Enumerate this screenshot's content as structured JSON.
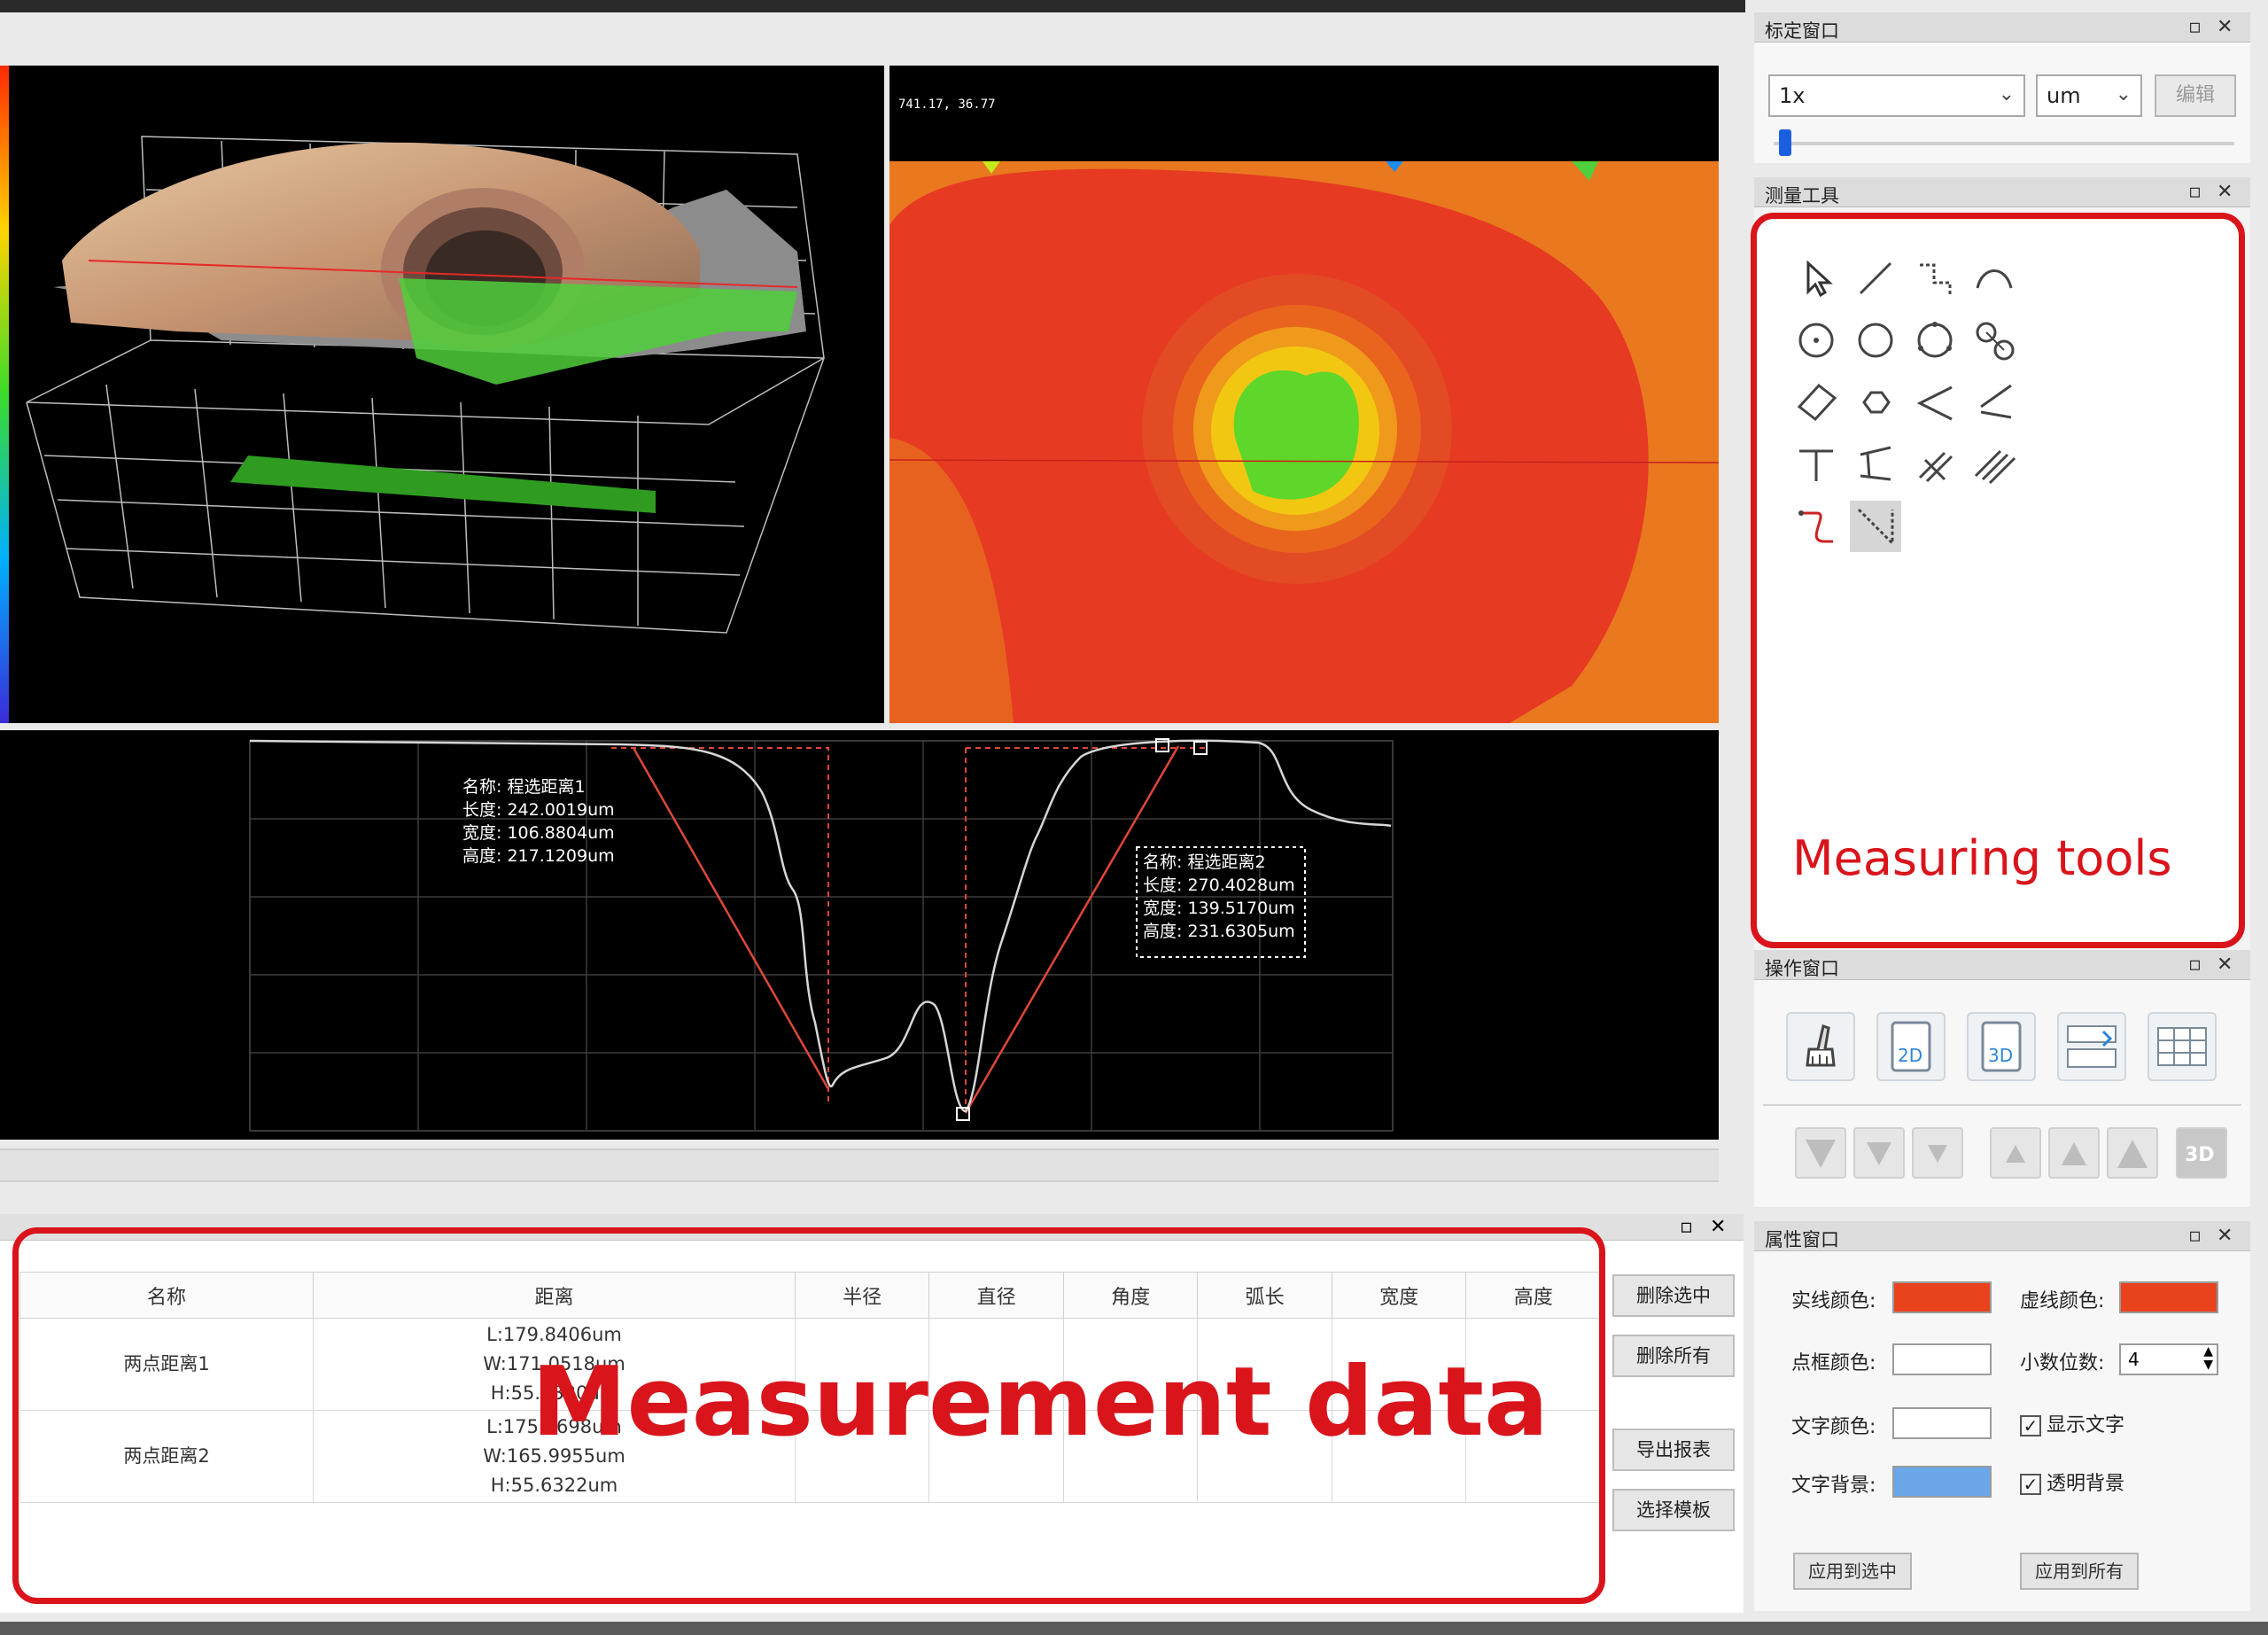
{
  "viewport_3d": {
    "name": "3d-view"
  },
  "viewport_2d": {
    "coords": "741.17, 36.77"
  },
  "profile": {
    "label1": {
      "name": "名称: 程选距离1",
      "length": "长度: 242.0019um",
      "width": "宽度: 106.8804um",
      "height": "高度: 217.1209um"
    },
    "label2": {
      "name": "名称: 程选距离2",
      "length": "长度: 270.4028um",
      "width": "宽度: 139.5170um",
      "height": "高度: 231.6305um"
    }
  },
  "calib_panel": {
    "title": "标定窗口",
    "magnification": "1x",
    "unit": "um",
    "edit_label": "编辑",
    "slider_value": 0.02
  },
  "tools_panel": {
    "title": "测量工具",
    "caption": "Measuring tools",
    "tools": [
      "pointer-icon",
      "line-icon",
      "polyline-icon",
      "arc-icon",
      "circle-center-icon",
      "circle-icon",
      "circle-3pt-icon",
      "circle-pair-icon",
      "rectangle-icon",
      "polygon-icon",
      "angle-icon",
      "angle-2line-icon",
      "perpendicular-icon",
      "line-distance-icon",
      "parallel-icon",
      "parallel-multi-icon",
      "curve-icon",
      "diagonal-icon"
    ]
  },
  "op_panel": {
    "title": "操作窗口",
    "icons": [
      "brush-icon",
      "save-2d-icon",
      "save-3d-icon",
      "export-icon",
      "table-icon"
    ],
    "label_2d": "2D",
    "label_3d": "3D",
    "arrows_label_3d": "3D"
  },
  "prop_panel": {
    "title": "属性窗口",
    "solid_color_label": "实线颜色:",
    "dashed_color_label": "虚线颜色:",
    "point_color_label": "点框颜色:",
    "decimals_label": "小数位数:",
    "decimals_value": "4",
    "text_color_label": "文字颜色:",
    "show_text_label": "显示文字",
    "text_bg_label": "文字背景:",
    "transparent_bg_label": "透明背景",
    "apply_selected_label": "应用到选中",
    "apply_all_label": "应用到所有",
    "colors": {
      "solid": "#e8431c",
      "dashed": "#e8431c",
      "point": "#ffffff",
      "text": "#ffffff",
      "text_bg": "#6aa6e8"
    }
  },
  "data_table": {
    "caption": "Measurement data",
    "headers": [
      "名称",
      "距离",
      "半径",
      "直径",
      "角度",
      "弧长",
      "宽度",
      "高度"
    ],
    "rows": [
      {
        "name": "两点距离1",
        "dist1": "L:179.8406um",
        "dist2": "W:171.0518um",
        "dist3": "H:55.5330um"
      },
      {
        "name": "两点距离2",
        "dist1": "L:175.0698um",
        "dist2": "W:165.9955um",
        "dist3": "H:55.6322um"
      }
    ],
    "buttons": {
      "delete_selected": "删除选中",
      "delete_all": "删除所有",
      "export_report": "导出报表",
      "select_template": "选择模板"
    }
  }
}
